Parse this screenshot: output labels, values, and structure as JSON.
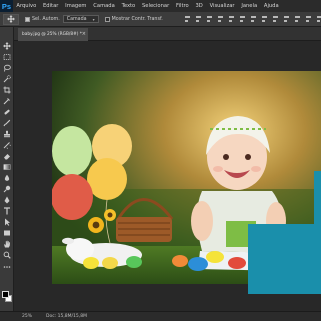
{
  "app": {
    "logo": "Ps"
  },
  "menu": [
    "Arquivo",
    "Editar",
    "Imagem",
    "Camada",
    "Texto",
    "Selecionar",
    "Filtro",
    "3D",
    "Visualizar",
    "Janela",
    "Ajuda"
  ],
  "options": {
    "auto_select_label": "Sel. Autom.",
    "layer_select_value": "Camada",
    "transform_label": "Mostrar Contr. Transf."
  },
  "document": {
    "tab_label": "baby.jpg @ 25% (RGB/8#) *",
    "close_glyph": "×"
  },
  "status": {
    "zoom": "25%",
    "doc_info": "Doc: 15,8M/15,8M"
  },
  "tools": [
    "move-icon",
    "marquee-icon",
    "lasso-icon",
    "quick-select-icon",
    "crop-icon",
    "eyedropper-icon",
    "healing-brush-icon",
    "brush-icon",
    "clone-stamp-icon",
    "history-brush-icon",
    "eraser-icon",
    "gradient-icon",
    "blur-icon",
    "dodge-icon",
    "pen-icon",
    "type-icon",
    "path-select-icon",
    "rectangle-icon",
    "hand-icon",
    "zoom-icon"
  ],
  "colors": {
    "overlay_blue": "#1a8fab",
    "foreground": "#000000",
    "background": "#ffffff"
  }
}
